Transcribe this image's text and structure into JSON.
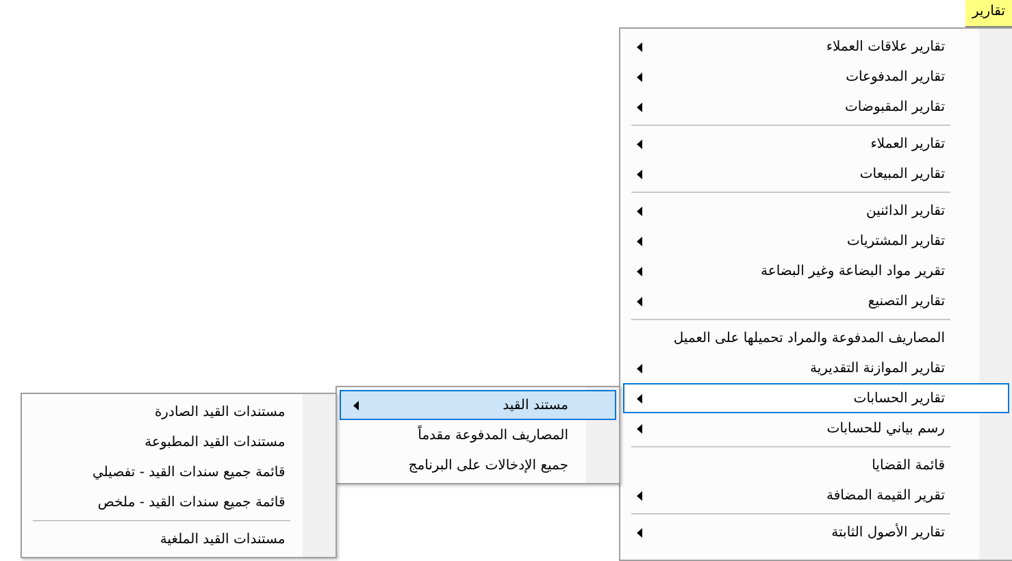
{
  "menubar": [
    {
      "label": "تقارير",
      "selected": true
    }
  ],
  "menu": {
    "items": [
      {
        "kind": "item",
        "label": "تقارير علاقات العملاء",
        "has_submenu": true,
        "selected": false
      },
      {
        "kind": "item",
        "label": "تقارير المدفوعات",
        "has_submenu": true,
        "selected": false
      },
      {
        "kind": "item",
        "label": "تقارير المقبوضات",
        "has_submenu": true,
        "selected": false
      },
      {
        "kind": "separator"
      },
      {
        "kind": "item",
        "label": "تقارير العملاء",
        "has_submenu": true,
        "selected": false
      },
      {
        "kind": "item",
        "label": "تقارير المبيعات",
        "has_submenu": true,
        "selected": false
      },
      {
        "kind": "separator"
      },
      {
        "kind": "item",
        "label": "تقارير الدائنين",
        "has_submenu": true,
        "selected": false
      },
      {
        "kind": "item",
        "label": "تقارير المشتريات",
        "has_submenu": true,
        "selected": false
      },
      {
        "kind": "item",
        "label": "تقرير مواد البضاعة وغير البضاعة",
        "has_submenu": true,
        "selected": false
      },
      {
        "kind": "item",
        "label": "تقارير التصنيع",
        "has_submenu": true,
        "selected": false
      },
      {
        "kind": "separator"
      },
      {
        "kind": "item",
        "label": "المصاريف المدفوعة والمراد تحميلها على العميل",
        "has_submenu": false,
        "selected": false
      },
      {
        "kind": "item",
        "label": "تقارير الموازنة التقديرية",
        "has_submenu": true,
        "selected": false
      },
      {
        "kind": "item",
        "label": "تقارير الحسابات",
        "has_submenu": true,
        "selected": true,
        "children": [
          {
            "kind": "item",
            "label": "مستند القيد",
            "has_submenu": true,
            "selected": true,
            "children": [
              {
                "kind": "item",
                "label": "مستندات القيد الصادرة",
                "has_submenu": false,
                "selected": false
              },
              {
                "kind": "item",
                "label": "مستندات القيد المطبوعة",
                "has_submenu": false,
                "selected": false
              },
              {
                "kind": "item",
                "label": "قائمة جميع سندات القيد - تفصيلي",
                "has_submenu": false,
                "selected": false
              },
              {
                "kind": "item",
                "label": "قائمة جميع سندات القيد - ملخص",
                "has_submenu": false,
                "selected": false
              },
              {
                "kind": "separator"
              },
              {
                "kind": "item",
                "label": "مستندات القيد الملغية",
                "has_submenu": false,
                "selected": false
              }
            ]
          },
          {
            "kind": "item",
            "label": "المصاريف المدفوعة مقدماً",
            "has_submenu": false,
            "selected": false
          },
          {
            "kind": "item",
            "label": "جميع الإدخالات على البرنامج",
            "has_submenu": false,
            "selected": false
          }
        ]
      },
      {
        "kind": "item",
        "label": "رسم بياني للحسابات",
        "has_submenu": true,
        "selected": false
      },
      {
        "kind": "separator"
      },
      {
        "kind": "item",
        "label": "قائمة القضايا",
        "has_submenu": false,
        "selected": false
      },
      {
        "kind": "item",
        "label": "تقرير القيمة المضافة",
        "has_submenu": true,
        "selected": false
      },
      {
        "kind": "separator"
      },
      {
        "kind": "item",
        "label": "تقارير الأصول الثابتة",
        "has_submenu": true,
        "selected": false
      }
    ]
  }
}
